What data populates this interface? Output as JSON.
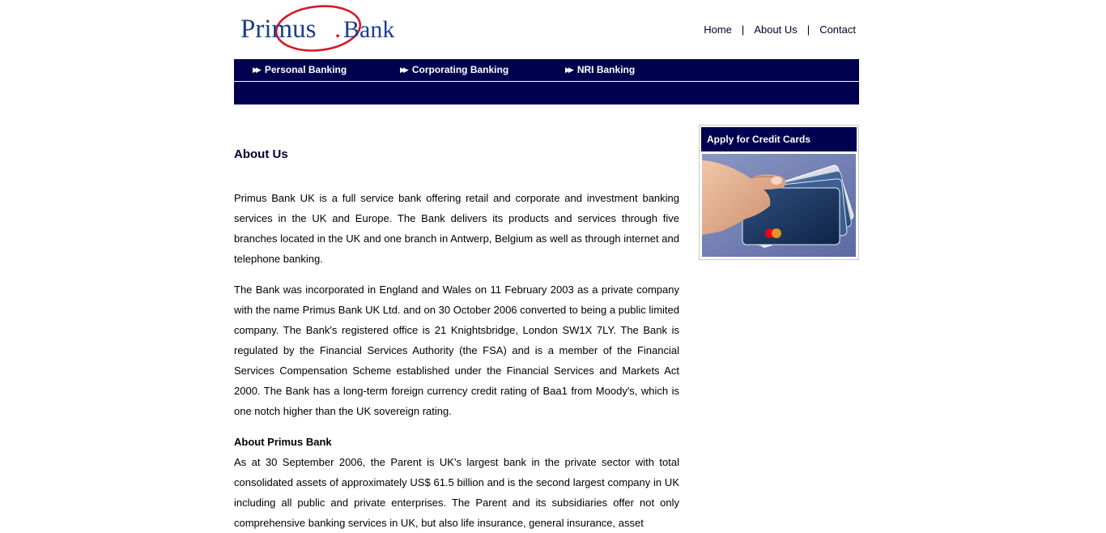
{
  "logo": {
    "word1": "Primus",
    "dot": ".",
    "word2": "Bank"
  },
  "top_nav": {
    "home": "Home",
    "about": "About Us",
    "contact": "Contact",
    "separator": "|"
  },
  "main_nav": {
    "items": [
      {
        "label": "Personal Banking"
      },
      {
        "label": "Corporating Banking"
      },
      {
        "label": "NRI Banking"
      }
    ]
  },
  "content": {
    "title": "About Us",
    "paragraph1": "Primus Bank UK is a full service bank offering retail and corporate and investment banking services in the UK and Europe. The Bank delivers its products and services through five branches located in the UK and one branch in Antwerp, Belgium as well as through internet and telephone banking.",
    "paragraph2": "The Bank was incorporated in England and Wales on 11 February 2003 as a private company with the name Primus Bank UK Ltd. and on 30 October 2006 converted to being a public limited company. The Bank's registered office is 21 Knightsbridge, London SW1X 7LY. The Bank is regulated by the Financial Services Authority (the FSA) and is a member of the Financial Services Compensation Scheme established under the Financial Services and Markets Act 2000. The Bank has a long-term foreign currency credit rating of Baa1 from Moody's, which is one notch higher than the UK sovereign rating.",
    "subheading": "About Primus Bank",
    "paragraph3": "As at 30 September 2006, the Parent is UK's largest bank in the private sector with total consolidated assets of approximately US$ 61.5 billion and is the second largest company in UK including all public and private enterprises. The Parent and its subsidiaries offer not only comprehensive banking services in UK, but also life insurance, general insurance, asset"
  },
  "sidebar": {
    "credit_card_title": "Apply for Credit Cards",
    "credit_card_image": "hand-holding-credit-cards-image"
  },
  "colors": {
    "brand_navy": "#000050",
    "logo_blue": "#1a3f8f",
    "logo_red": "#d7192a",
    "link_text": "#000033"
  }
}
